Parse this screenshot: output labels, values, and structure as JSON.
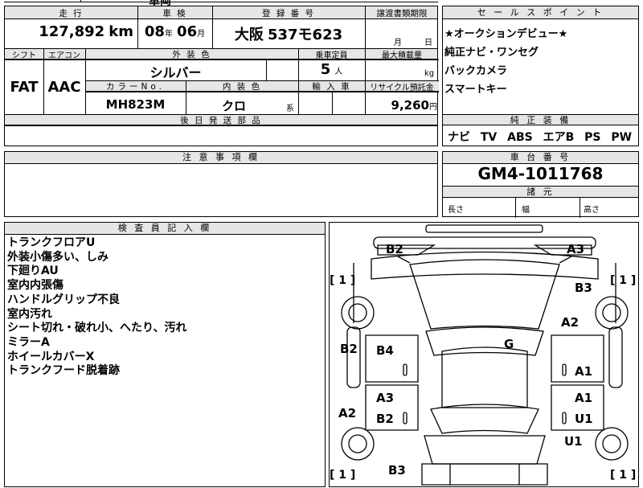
{
  "top_fragment": "車両",
  "headers": {
    "mileage": "走 行",
    "inspection": "車 検",
    "registration": "登 録 番 号",
    "transfer_deadline": "譲渡書類期限",
    "sales_points": "セ ー ル ス ポ イ ン ト",
    "shift": "シフト",
    "aircon": "エアコン",
    "exterior_color": "外 装 色",
    "capacity": "乗車定員",
    "max_load": "最大積載量",
    "color_no": "カラーNo.",
    "interior_color": "内 装 色",
    "import": "輸 入 車",
    "recycle": "リサイクル預託金",
    "later_parts": "後 日 発 送 部 品",
    "genuine": "純 正 装 備",
    "notes": "注 意 事 項 欄",
    "chassis_no": "車 台 番 号",
    "dimensions": "諸 元",
    "inspector": "検 査 員 記 入 欄"
  },
  "vehicle": {
    "mileage": "127,892",
    "mileage_unit": "km",
    "insp_year": "08",
    "insp_year_unit": "年",
    "insp_month": "06",
    "insp_month_unit": "月",
    "plate_area": "大阪",
    "plate_number": "537モ623",
    "transfer_month": "月",
    "transfer_day": "日",
    "shift": "FAT",
    "aircon": "AAC",
    "exterior_color": "シルバー",
    "capacity": "5",
    "capacity_unit": "人",
    "max_load_unit": "kg",
    "color_no": "MH823M",
    "interior_color": "クロ",
    "interior_suffix": "系",
    "recycle": "9,260",
    "recycle_unit": "円",
    "chassis_no": "GM4-1011768",
    "dim_length": "長さ",
    "dim_width": "幅",
    "dim_height": "高さ"
  },
  "sales_points": [
    "★オークションデビュー★",
    "純正ナビ・ワンセグ",
    "バックカメラ",
    "スマートキー"
  ],
  "genuine_equipment": "ナビ TV ABS エアB PS PW",
  "inspector_notes": [
    "トランクフロアU",
    "外装小傷多い、しみ",
    "下廻りAU",
    "室内内張傷",
    "ハンドルグリップ不良",
    "室内汚れ",
    "シート切れ・破れ小、へたり、汚れ",
    "ミラーA",
    "ホイールカバーX",
    "トランクフード脱着跡"
  ],
  "damage": {
    "b2_top": "B2",
    "a3_top": "A3",
    "b3_right": "B3",
    "a2_right": "A2",
    "g_roof": "G",
    "b2_left": "B2",
    "b4": "B4",
    "a1_upper": "A1",
    "a3_mid": "A3",
    "a1_right": "A1",
    "a2_left": "A2",
    "b2_mid": "B2",
    "u1_right": "U1",
    "u1_lower": "U1",
    "b3_bottom": "B3",
    "tire_tl": "[ 1 ]",
    "tire_tr": "[ 1 ]",
    "tire_bl": "[ 1 ]",
    "tire_br": "[ 1 ]"
  }
}
